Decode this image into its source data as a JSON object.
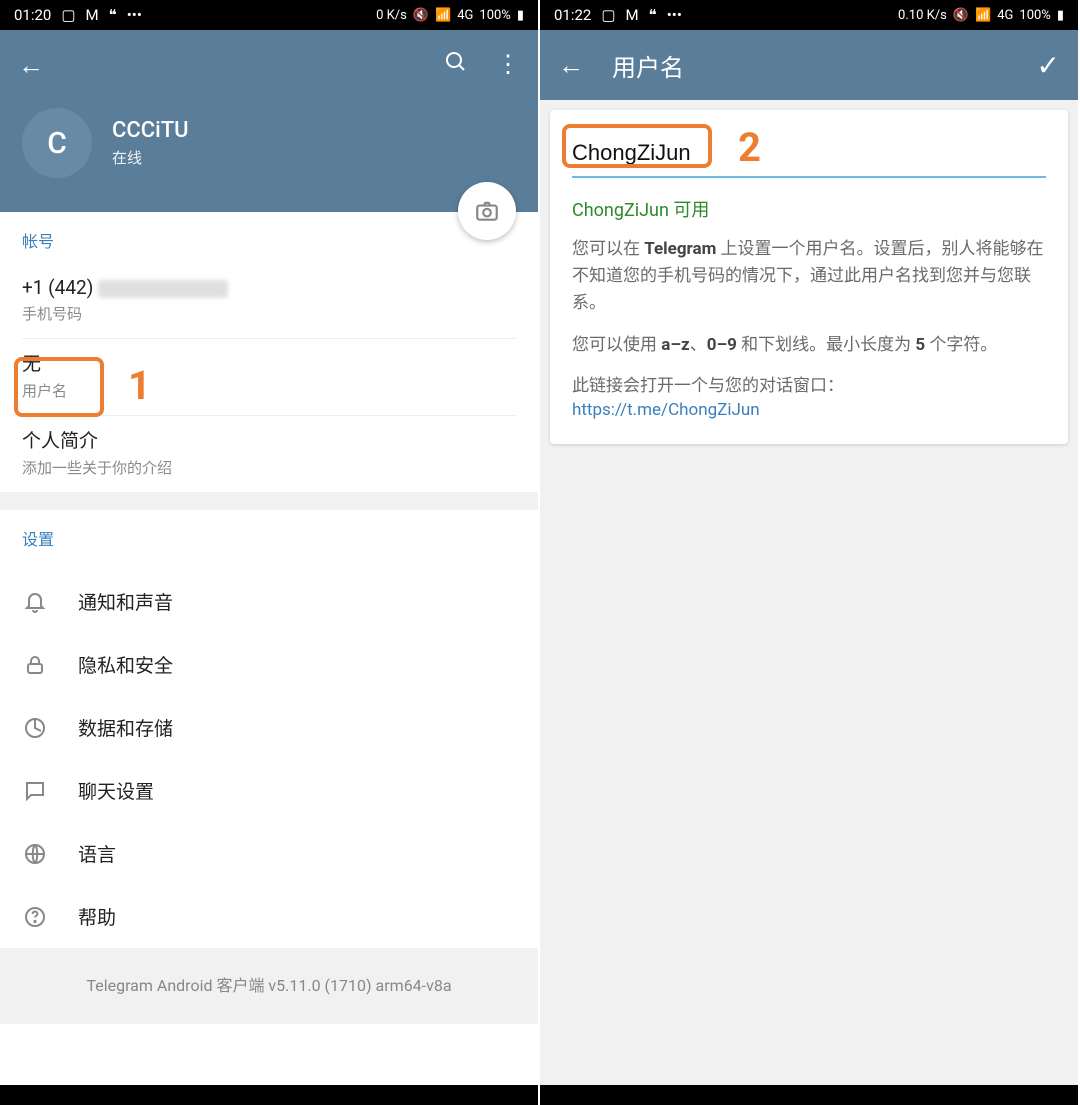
{
  "left": {
    "status": {
      "time": "01:20",
      "net": "0 K/s",
      "sig": "4G",
      "batt": "100%"
    },
    "profile": {
      "avatar_letter": "C",
      "name": "CCCiTU",
      "status": "在线"
    },
    "account": {
      "header": "帐号",
      "phone": {
        "value": "+1 (442)",
        "label": "手机号码"
      },
      "username": {
        "value": "无",
        "label": "用户名"
      },
      "bio": {
        "value": "个人简介",
        "label": "添加一些关于你的介绍"
      }
    },
    "settings": {
      "header": "设置",
      "items": [
        "通知和声音",
        "隐私和安全",
        "数据和存储",
        "聊天设置",
        "语言",
        "帮助"
      ]
    },
    "footer": "Telegram Android 客户端 v5.11.0 (1710) arm64-v8a",
    "callout": "1"
  },
  "right": {
    "status": {
      "time": "01:22",
      "net": "0.10 K/s",
      "sig": "4G",
      "batt": "100%"
    },
    "title": "用户名",
    "input_value": "ChongZiJun",
    "available": "ChongZiJun 可用",
    "desc1_a": "您可以在 ",
    "desc1_b": "Telegram",
    "desc1_c": " 上设置一个用户名。设置后，别人将能够在不知道您的手机号码的情况下，通过此用户名找到您并与您联系。",
    "desc2_a": "您可以使用 ",
    "desc2_b": "a–z",
    "desc2_c": "、",
    "desc2_d": "0–9",
    "desc2_e": " 和下划线。最小长度为 ",
    "desc2_f": "5",
    "desc2_g": " 个字符。",
    "desc3": "此链接会打开一个与您的对话窗口：",
    "link": "https://t.me/ChongZiJun",
    "callout": "2"
  }
}
